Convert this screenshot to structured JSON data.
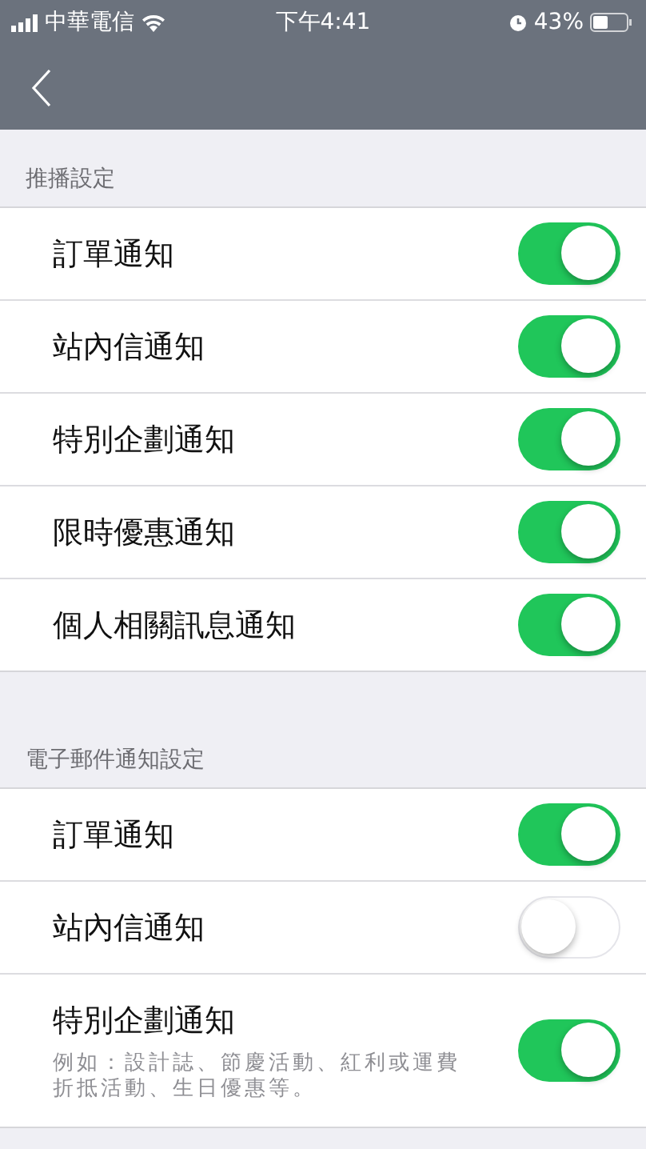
{
  "status_bar": {
    "carrier": "中華電信",
    "time": "下午4:41",
    "battery": "43%"
  },
  "sections": [
    {
      "title": "推播設定",
      "items": [
        {
          "label": "訂單通知",
          "on": true
        },
        {
          "label": "站內信通知",
          "on": true
        },
        {
          "label": "特別企劃通知",
          "on": true
        },
        {
          "label": "限時優惠通知",
          "on": true
        },
        {
          "label": "個人相關訊息通知",
          "on": true
        }
      ]
    },
    {
      "title": "電子郵件通知設定",
      "items": [
        {
          "label": "訂單通知",
          "on": true
        },
        {
          "label": "站內信通知",
          "on": false
        },
        {
          "label": "特別企劃通知",
          "on": true,
          "description": "例如：設計誌、節慶活動、紅利或運費折抵活動、生日優惠等。"
        }
      ]
    }
  ]
}
